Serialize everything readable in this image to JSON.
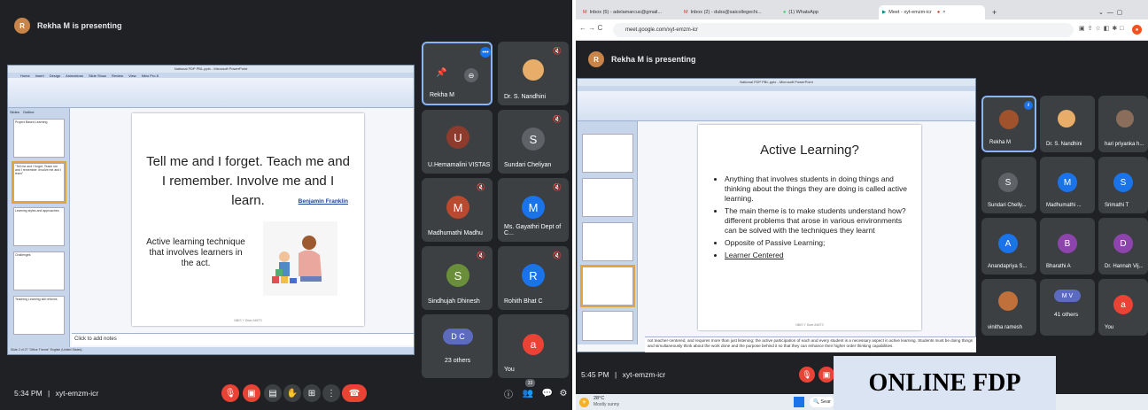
{
  "left": {
    "presenting_text": "Rekha M is presenting",
    "ppt_title": "National FDP PBL.pptx - Microsoft PowerPoint",
    "ribbon_tabs": [
      "Home",
      "Insert",
      "Design",
      "Animations",
      "Slide Show",
      "Review",
      "View",
      "Nitro Pro 8"
    ],
    "panel_tabs": [
      "Slides",
      "Outline"
    ],
    "thumbnails": [
      "Project Based Learning",
      "\"Tell me and I forget. Teach me and I remember. Involve me and I learn\"",
      "Learning styles and approaches",
      "Challenges",
      "Teaching Learning still reforms"
    ],
    "slide": {
      "quote": "Tell me and I forget. Teach me and I remember. Involve me and I learn.",
      "author": "Benjamin Franklin",
      "body": "Active learning technique that involves learners in the act.",
      "footer": "NBIS   Y Diwe   AMIT3"
    },
    "notes_text": "Click to add notes",
    "status_text": "Slide 2 of 27   \"Office Theme\"   English (United States)",
    "participants": [
      {
        "name": "Rekha M",
        "initial": ""
      },
      {
        "name": "Dr. S. Nandhini",
        "initial": ""
      },
      {
        "name": "U.Hemamalini VISTAS",
        "initial": "U"
      },
      {
        "name": "Sundari Cheliyan",
        "initial": "S"
      },
      {
        "name": "Madhumathi Madhu",
        "initial": "M"
      },
      {
        "name": "Ms. Gayathri Dept of C...",
        "initial": "M"
      },
      {
        "name": "Sindhujah Dhinesh",
        "initial": "S"
      },
      {
        "name": "Rohith Bhat C",
        "initial": "R"
      },
      {
        "name": "23 others",
        "initial": "D C"
      },
      {
        "name": "You",
        "initial": "a"
      }
    ],
    "time": "5:34 PM",
    "separator": "|",
    "meeting_code": "xyt-emzm-icr",
    "people_count": "33"
  },
  "right": {
    "tabs": [
      "Inbox (5) - adelamarcus@gmail...",
      "Inbox (2) - dubs@saicollegechi...",
      "(1) WhatsApp",
      "Meet - xyt-emzm-icr"
    ],
    "url": "meet.google.com/xyt-emzm-icr",
    "presenting_text": "Rekha M is presenting",
    "ppt_title": "National FDP PBL.pptx - Microsoft PowerPoint",
    "slide": {
      "title": "Active Learning?",
      "bullets": [
        "Anything that involves students in doing things and thinking about the things they are doing is called active learning.",
        "The main theme is to make students understand how? different problems that arose in various environments can be solved with the techniques they learnt",
        "Opposite of Passive Learning;",
        "Learner Centered"
      ],
      "footer": "NBIS   Y Diwe   AMIT3"
    },
    "notes_text": "not teacher-centered, and requires more than just listening; the active participation of each and every student is a necessary aspect in active learning. Students must be doing things and simultaneously think about the work done and the purpose behind it so that they can enhance their higher order thinking capabilities.",
    "participants": [
      {
        "name": "Rekha M",
        "initial": ""
      },
      {
        "name": "Dr. S. Nandhini",
        "initial": ""
      },
      {
        "name": "hari priyanka h...",
        "initial": ""
      },
      {
        "name": "Sundari Chelly...",
        "initial": "S"
      },
      {
        "name": "Madhumathi ...",
        "initial": "M"
      },
      {
        "name": "Srimathi T",
        "initial": "S"
      },
      {
        "name": "Anandapriya S...",
        "initial": "A"
      },
      {
        "name": "Bharathi A",
        "initial": "B"
      },
      {
        "name": "Dr. Hannah Vij...",
        "initial": "D"
      },
      {
        "name": "vinitha ramesh",
        "initial": ""
      },
      {
        "name": "41 others",
        "initial": "M V"
      },
      {
        "name": "You",
        "initial": "a"
      }
    ],
    "time": "5:45 PM",
    "separator": "|",
    "meeting_code": "xyt-emzm-icr",
    "weather_temp": "28°C",
    "weather_desc": "Mostly sunny",
    "search_label": "Sear",
    "banner": "ONLINE FDP"
  },
  "colors": {
    "meet_bg": "#202124",
    "tile_bg": "#3c4043",
    "end_call": "#ea4335",
    "accent_blue": "#8ab4f8"
  }
}
